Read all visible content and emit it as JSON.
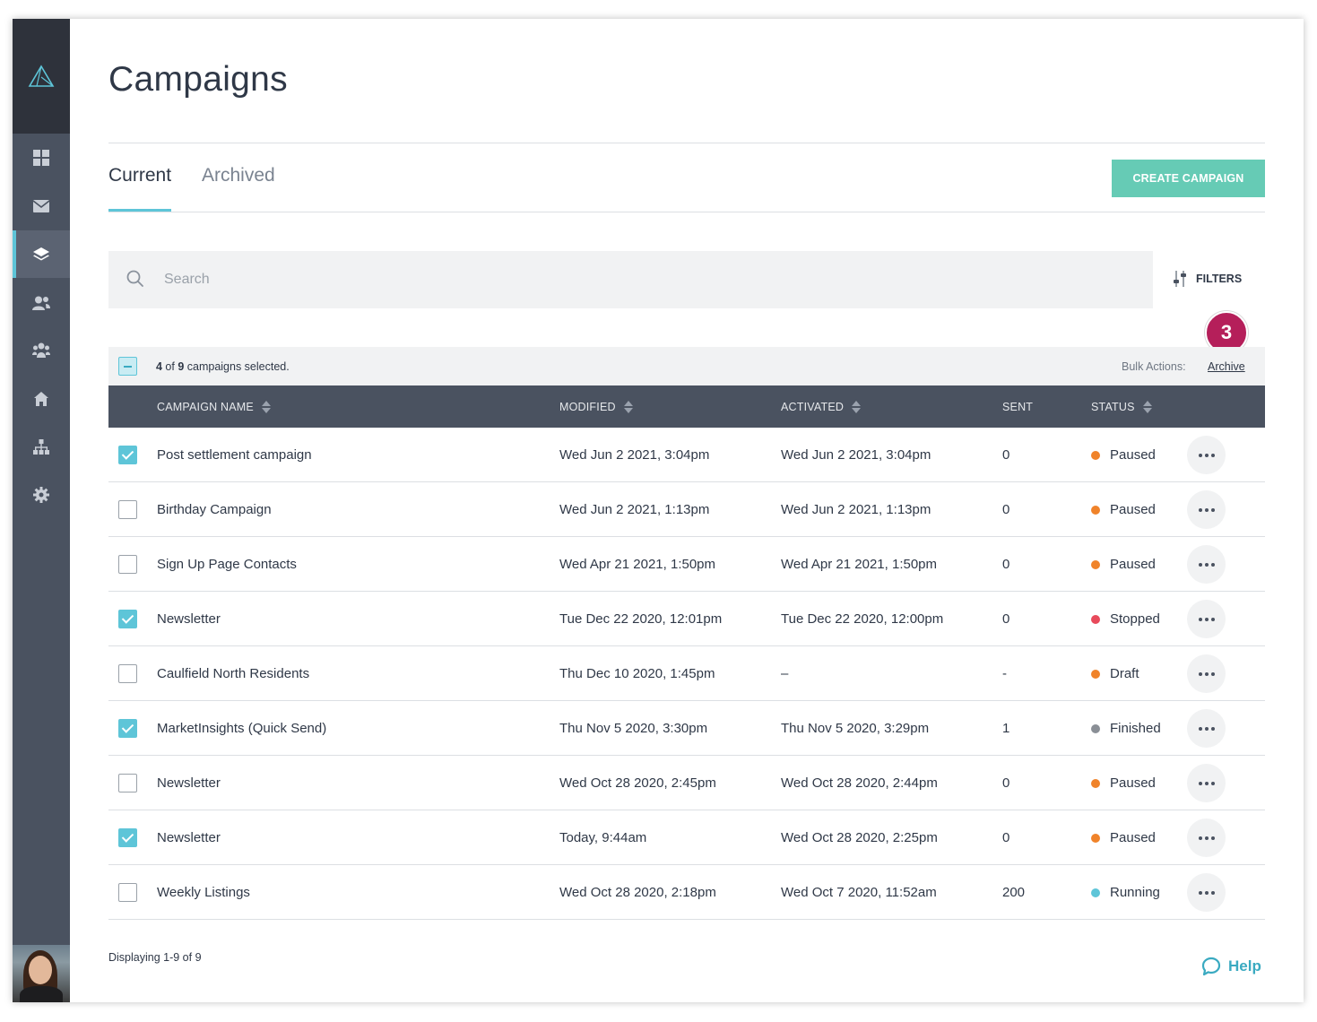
{
  "page": {
    "title": "Campaigns"
  },
  "tabs": [
    {
      "label": "Current",
      "active": true
    },
    {
      "label": "Archived",
      "active": false
    }
  ],
  "actions": {
    "create_label": "CREATE CAMPAIGN",
    "filters_label": "FILTERS"
  },
  "search": {
    "placeholder": "Search",
    "value": ""
  },
  "selection": {
    "selected": "4",
    "of_text": " of ",
    "total": "9",
    "suffix": " campaigns selected.",
    "bulk_label": "Bulk Actions:",
    "archive_label": "Archive",
    "badge": "3"
  },
  "table": {
    "headers": {
      "name": "CAMPAIGN NAME",
      "modified": "MODIFIED",
      "activated": "ACTIVATED",
      "sent": "SENT",
      "status": "STATUS"
    },
    "rows": [
      {
        "checked": true,
        "name": "Post settlement campaign",
        "modified": "Wed Jun 2 2021, 3:04pm",
        "activated": "Wed Jun 2 2021, 3:04pm",
        "sent": "0",
        "status": "Paused",
        "status_color": "#f0832a"
      },
      {
        "checked": false,
        "name": "Birthday Campaign",
        "modified": "Wed Jun 2 2021, 1:13pm",
        "activated": "Wed Jun 2 2021, 1:13pm",
        "sent": "0",
        "status": "Paused",
        "status_color": "#f0832a"
      },
      {
        "checked": false,
        "name": "Sign Up Page Contacts",
        "modified": "Wed Apr 21 2021, 1:50pm",
        "activated": "Wed Apr 21 2021, 1:50pm",
        "sent": "0",
        "status": "Paused",
        "status_color": "#f0832a"
      },
      {
        "checked": true,
        "name": "Newsletter",
        "modified": "Tue Dec 22 2020, 12:01pm",
        "activated": "Tue Dec 22 2020, 12:00pm",
        "sent": "0",
        "status": "Stopped",
        "status_color": "#e84a5b"
      },
      {
        "checked": false,
        "name": "Caulfield North Residents",
        "modified": "Thu Dec 10 2020, 1:45pm",
        "activated": "–",
        "sent": "-",
        "status": "Draft",
        "status_color": "#f0832a"
      },
      {
        "checked": true,
        "name": "MarketInsights (Quick Send)",
        "modified": "Thu Nov 5 2020, 3:30pm",
        "activated": "Thu Nov 5 2020, 3:29pm",
        "sent": "1",
        "status": "Finished",
        "status_color": "#8a8f96"
      },
      {
        "checked": false,
        "name": "Newsletter",
        "modified": "Wed Oct 28 2020, 2:45pm",
        "activated": "Wed Oct 28 2020, 2:44pm",
        "sent": "0",
        "status": "Paused",
        "status_color": "#f0832a"
      },
      {
        "checked": true,
        "name": "Newsletter",
        "modified": "Today, 9:44am",
        "activated": "Wed Oct 28 2020, 2:25pm",
        "sent": "0",
        "status": "Paused",
        "status_color": "#f0832a"
      },
      {
        "checked": false,
        "name": "Weekly Listings",
        "modified": "Wed Oct 28 2020, 2:18pm",
        "activated": "Wed Oct 7 2020, 11:52am",
        "sent": "200",
        "status": "Running",
        "status_color": "#5ec5d8"
      }
    ]
  },
  "footer": {
    "count_text": "Displaying 1-9 of 9",
    "help_label": "Help"
  },
  "sidebar": {
    "items": [
      {
        "icon": "dashboard-grid-icon",
        "active": false
      },
      {
        "icon": "envelope-icon",
        "active": false
      },
      {
        "icon": "layers-icon",
        "active": true
      },
      {
        "icon": "contacts-icon",
        "active": false
      },
      {
        "icon": "groups-icon",
        "active": false
      },
      {
        "icon": "home-icon",
        "active": false
      },
      {
        "icon": "sitemap-icon",
        "active": false
      },
      {
        "icon": "gear-icon",
        "active": false
      }
    ]
  },
  "colors": {
    "accent": "#5ec5d8",
    "create_button": "#66cbb5",
    "sidebar": "#4a5260",
    "badge": "#b51f5a"
  }
}
